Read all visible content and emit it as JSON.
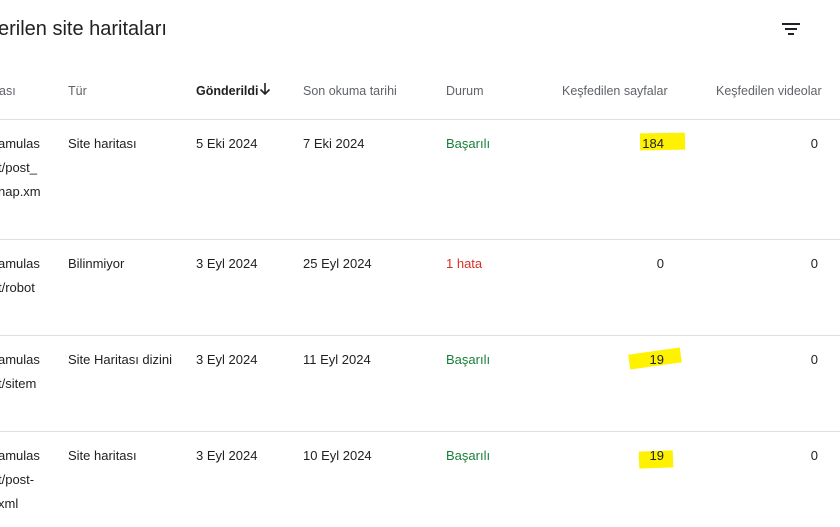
{
  "title": "erilen site haritaları",
  "icons": {
    "filter": "filter-icon",
    "sort": "arrow-down-icon"
  },
  "colors": {
    "success": "#188038",
    "error": "#d93025",
    "highlight": "#fff200"
  },
  "columns": {
    "url": "ası",
    "type": "Tür",
    "submitted": "Gönderildi",
    "last_read": "Son okuma tarihi",
    "status": "Durum",
    "pages": "Keşfedilen sayfalar",
    "videos": "Keşfedilen videolar"
  },
  "rows": [
    {
      "url_lines": [
        "amulas",
        "t/post_",
        "nap.xm"
      ],
      "type": "Site haritası",
      "submitted": "5 Eki 2024",
      "last_read": "7 Eki 2024",
      "status": "Başarılı",
      "pages": "184",
      "videos": "0"
    },
    {
      "url_lines": [
        "amulas",
        "t/robot"
      ],
      "type": "Bilinmiyor",
      "submitted": "3 Eyl 2024",
      "last_read": "25 Eyl 2024",
      "status": "1 hata",
      "pages": "0",
      "videos": "0"
    },
    {
      "url_lines": [
        "amulas",
        "t/sitem"
      ],
      "type": "Site Haritası dizini",
      "submitted": "3 Eyl 2024",
      "last_read": "11 Eyl 2024",
      "status": "Başarılı",
      "pages": "19",
      "videos": "0"
    },
    {
      "url_lines": [
        "amulas",
        "t/post-",
        "xml"
      ],
      "type": "Site haritası",
      "submitted": "3 Eyl 2024",
      "last_read": "10 Eyl 2024",
      "status": "Başarılı",
      "pages": "19",
      "videos": "0"
    }
  ]
}
